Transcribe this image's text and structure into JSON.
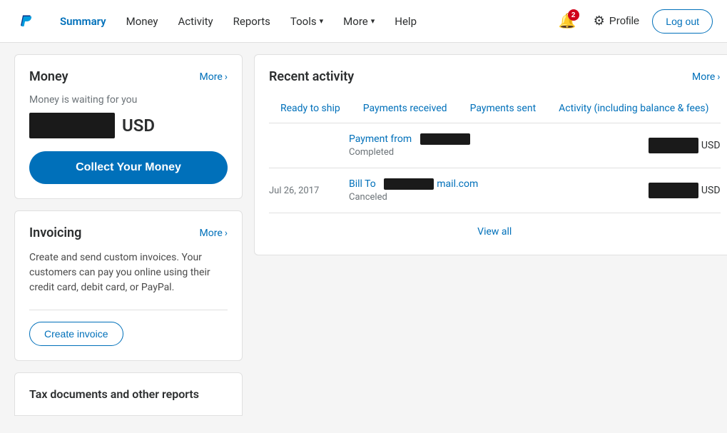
{
  "header": {
    "logo_alt": "PayPal",
    "nav": [
      {
        "id": "summary",
        "label": "Summary",
        "active": true,
        "has_chevron": false
      },
      {
        "id": "money",
        "label": "Money",
        "active": false,
        "has_chevron": false
      },
      {
        "id": "activity",
        "label": "Activity",
        "active": false,
        "has_chevron": false
      },
      {
        "id": "reports",
        "label": "Reports",
        "active": false,
        "has_chevron": false
      },
      {
        "id": "tools",
        "label": "Tools",
        "active": false,
        "has_chevron": true
      },
      {
        "id": "more",
        "label": "More",
        "active": false,
        "has_chevron": true
      },
      {
        "id": "help",
        "label": "Help",
        "active": false,
        "has_chevron": false
      }
    ],
    "notification_count": "2",
    "profile_label": "Profile",
    "logout_label": "Log out"
  },
  "money_card": {
    "title": "Money",
    "more_label": "More",
    "waiting_label": "Money is waiting for you",
    "currency": "USD",
    "collect_button": "Collect Your Money"
  },
  "invoicing_card": {
    "title": "Invoicing",
    "more_label": "More",
    "description": "Create and send custom invoices. Your customers can pay you online using their credit card, debit card, or PayPal.",
    "create_button": "Create invoice"
  },
  "tax_card": {
    "title": "Tax documents and other reports"
  },
  "activity_section": {
    "title": "Recent activity",
    "more_label": "More",
    "tabs": [
      {
        "id": "ready-to-ship",
        "label": "Ready to ship",
        "active": false
      },
      {
        "id": "payments-received",
        "label": "Payments received",
        "active": false
      },
      {
        "id": "payments-sent",
        "label": "Payments sent",
        "active": false
      },
      {
        "id": "activity-balance",
        "label": "Activity (including balance & fees)",
        "active": false
      }
    ],
    "rows": [
      {
        "id": "row1",
        "has_date": false,
        "link_prefix": "Payment from",
        "status": "Completed",
        "currency": "USD"
      },
      {
        "id": "row2",
        "date": "Jul 26, 2017",
        "link_prefix": "Bill To",
        "email_suffix": "mail.com",
        "status": "Canceled",
        "currency": "USD"
      }
    ],
    "view_all_label": "View all"
  }
}
